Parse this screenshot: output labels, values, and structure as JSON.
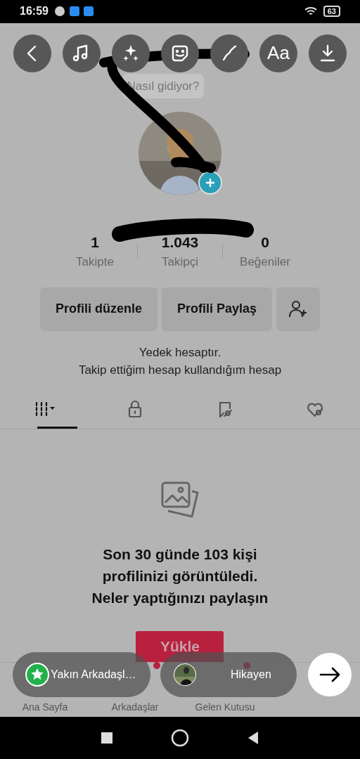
{
  "status_bar": {
    "time": "16:59",
    "battery": "63"
  },
  "toolbar": [
    {
      "kind": "back"
    },
    {
      "kind": "music"
    },
    {
      "kind": "effects"
    },
    {
      "kind": "sticker"
    },
    {
      "kind": "draw"
    },
    {
      "kind": "text",
      "label": "Aa"
    },
    {
      "kind": "download"
    }
  ],
  "profile": {
    "bubble": "Nasıl gidiyor?",
    "stats": [
      {
        "value": "1",
        "label": "Takipte"
      },
      {
        "value": "1.043",
        "label": "Takipçi"
      },
      {
        "value": "0",
        "label": "Beğeniler"
      }
    ],
    "buttons": [
      "Profili düzenle",
      "Profili Paylaş"
    ],
    "bio": [
      "Yedek hesaptır.",
      "Takip ettiğim hesap kullandığım hesap"
    ]
  },
  "tabs": [
    {
      "kind": "videos",
      "selected": true
    },
    {
      "kind": "private",
      "selected": false
    },
    {
      "kind": "saved",
      "selected": false
    },
    {
      "kind": "liked",
      "selected": false
    }
  ],
  "empty_state": {
    "message": [
      "Son 30 günde 103 kişi",
      "profilinizi görüntüledi.",
      "Neler yaptığınızı paylaşın"
    ],
    "button": "Yükle"
  },
  "bottom_nav": [
    {
      "label": "Ana Sayfa",
      "badge": false
    },
    {
      "label": "Arkadaşlar",
      "badge": true
    },
    {
      "label": "Gelen Kutusu",
      "badge": true
    }
  ],
  "share_options": [
    {
      "kind": "close_friends",
      "label": "Yakın Arkadaşl…"
    },
    {
      "kind": "story",
      "label": "Hikayen"
    }
  ]
}
